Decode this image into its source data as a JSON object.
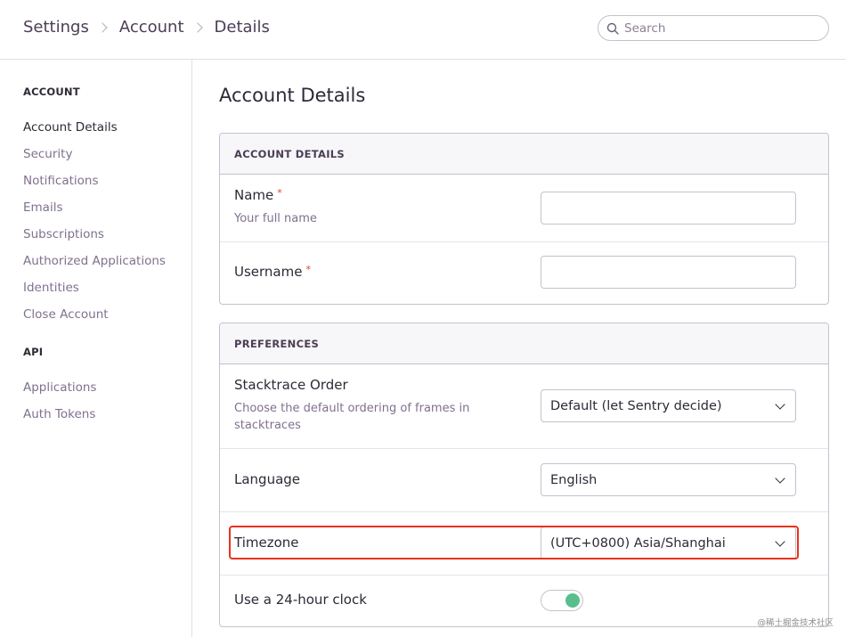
{
  "breadcrumb": [
    "Settings",
    "Account",
    "Details"
  ],
  "search": {
    "placeholder": "Search"
  },
  "sidebar": {
    "account_heading": "ACCOUNT",
    "account_items": [
      "Account Details",
      "Security",
      "Notifications",
      "Emails",
      "Subscriptions",
      "Authorized Applications",
      "Identities",
      "Close Account"
    ],
    "active_item": "Account Details",
    "api_heading": "API",
    "api_items": [
      "Applications",
      "Auth Tokens"
    ]
  },
  "page": {
    "title": "Account Details"
  },
  "account_panel": {
    "heading": "ACCOUNT DETAILS",
    "name": {
      "label": "Name",
      "required_mark": "*",
      "help": "Your full name",
      "value": ""
    },
    "username": {
      "label": "Username",
      "required_mark": "*",
      "value": ""
    }
  },
  "preferences_panel": {
    "heading": "PREFERENCES",
    "stacktrace": {
      "label": "Stacktrace Order",
      "help": "Choose the default ordering of frames in stacktraces",
      "value": "Default (let Sentry decide)"
    },
    "language": {
      "label": "Language",
      "value": "English"
    },
    "timezone": {
      "label": "Timezone",
      "value": "(UTC+0800) Asia/Shanghai"
    },
    "clock": {
      "label": "Use a 24-hour clock",
      "enabled": true
    }
  },
  "colors": {
    "toggle_on": "#57be8c",
    "highlight_box": "#e8321e",
    "required": "#e03e2f"
  },
  "watermark": "@稀土掘金技术社区"
}
